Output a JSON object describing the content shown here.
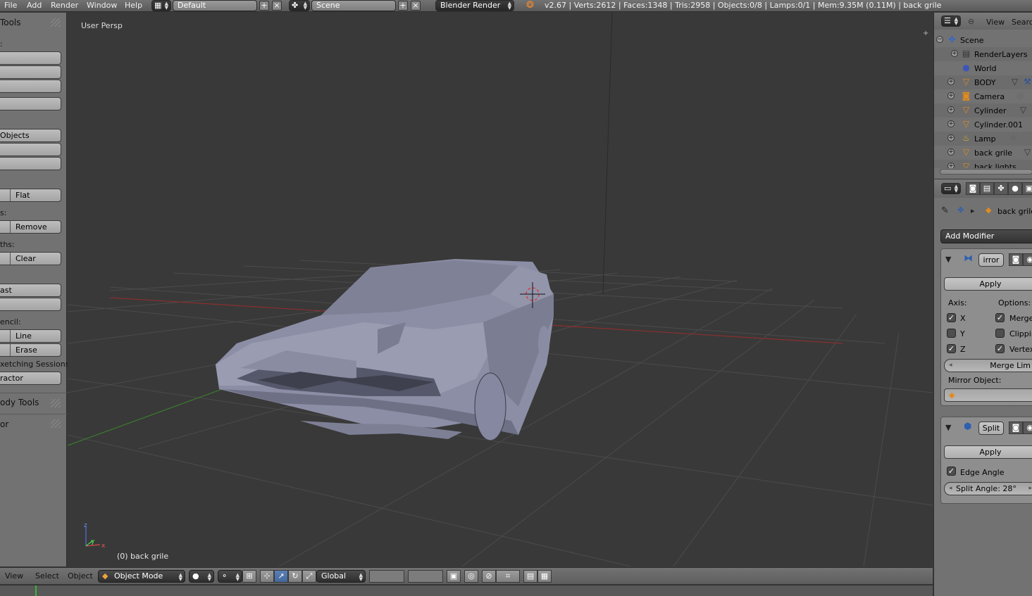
{
  "topbar": {
    "menus": [
      "File",
      "Add",
      "Render",
      "Window",
      "Help"
    ],
    "screen_layout": "Default",
    "scene": "Scene",
    "render_engine": "Blender Render",
    "stats": "v2.67 | Verts:2612 | Faces:1348 | Tris:2958 | Objects:0/8 | Lamps:0/1 | Mem:9.35M (0.11M) | back grile"
  },
  "toolshelf": {
    "title": "Tools",
    "labels": [
      ":",
      "s:",
      "ths:",
      "encil:"
    ],
    "buttons": [
      "Objects",
      "Flat",
      "Remove",
      "Clear",
      "ast",
      "Line",
      "Erase",
      "xetching Sessions",
      "ractor"
    ],
    "panels": [
      "ody Tools",
      "or"
    ]
  },
  "viewport": {
    "view_name": "User Persp",
    "active_object": "(0) back grile",
    "axis_labels": {
      "x": "x",
      "y": "y",
      "z": "z"
    }
  },
  "bottombar": {
    "menus": [
      "View",
      "Select",
      "Object"
    ],
    "mode": "Object Mode",
    "orientation": "Global"
  },
  "outliner": {
    "header": {
      "view": "View",
      "search": "Searc"
    },
    "items": [
      {
        "label": "Scene",
        "icon": "scene-icon"
      },
      {
        "label": "RenderLayers",
        "icon": "renderlayers-icon"
      },
      {
        "label": "World",
        "icon": "world-icon"
      },
      {
        "label": "BODY",
        "icon": "mesh-object-icon"
      },
      {
        "label": "Camera",
        "icon": "camera-icon"
      },
      {
        "label": "Cylinder",
        "icon": "mesh-object-icon"
      },
      {
        "label": "Cylinder.001",
        "icon": "mesh-object-icon"
      },
      {
        "label": "Lamp",
        "icon": "lamp-icon"
      },
      {
        "label": "back grile",
        "icon": "mesh-object-icon"
      },
      {
        "label": "back lights",
        "icon": "mesh-object-icon"
      }
    ]
  },
  "properties": {
    "breadcrumb_object": "back grile",
    "add_modifier": "Add Modifier",
    "mirror": {
      "name": "irror",
      "apply": "Apply",
      "axis_label": "Axis:",
      "options_label": "Options:",
      "axes": [
        {
          "label": "X",
          "checked": true
        },
        {
          "label": "Y",
          "checked": false
        },
        {
          "label": "Z",
          "checked": true
        }
      ],
      "options": [
        {
          "label": "Merge",
          "checked": true
        },
        {
          "label": "Clippin",
          "checked": false
        },
        {
          "label": "Vertex",
          "checked": true
        }
      ],
      "merge_limit": "Merge Lim",
      "mirror_object_label": "Mirror Object:"
    },
    "split": {
      "name": "Split",
      "apply": "Apply",
      "edge_angle": "Edge Angle",
      "split_angle": "Split Angle: 28°"
    }
  },
  "colors": {
    "panel_bg": "#727272",
    "viewport_bg": "#393939",
    "grid_line": "#4a4a4a",
    "x_axis": "#8a2f2f",
    "y_axis": "#3c7a2f",
    "car_body": "#8a8ca4"
  }
}
